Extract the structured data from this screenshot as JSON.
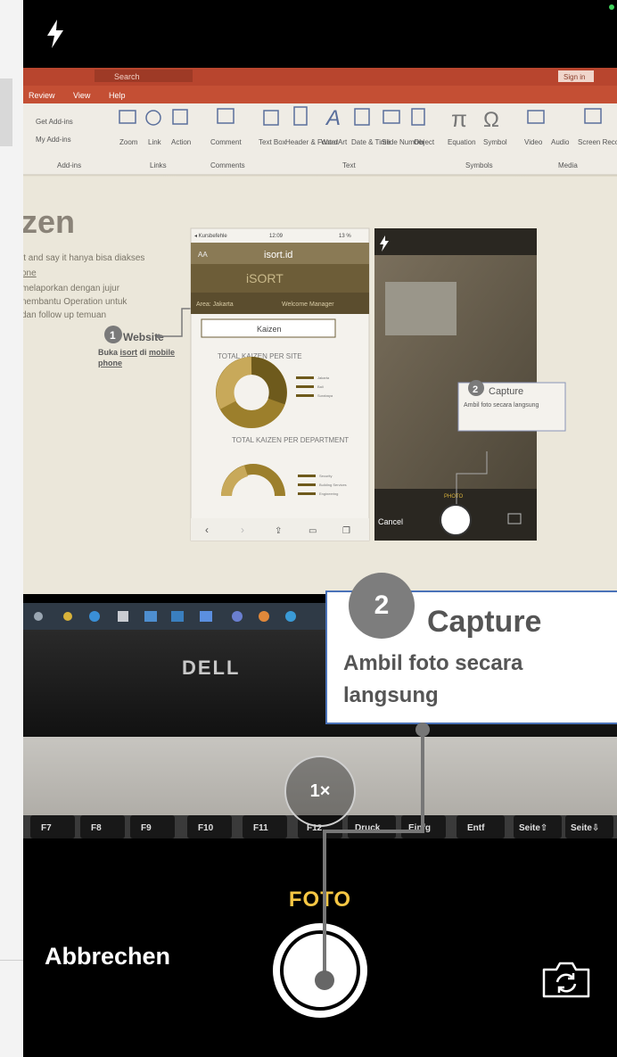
{
  "ribbon": {
    "search_placeholder": "Search",
    "sign_in_label": "Sign in",
    "tabs": [
      "Review",
      "View",
      "Help"
    ],
    "groups": {
      "addins": {
        "label": "Add-ins",
        "items": [
          "Get Add-ins",
          "My Add-ins"
        ]
      },
      "links": {
        "label": "Links",
        "items": [
          "Zoom",
          "Link",
          "Action"
        ]
      },
      "comments": {
        "label": "Comments",
        "items": [
          "Comment"
        ]
      },
      "text": {
        "label": "Text",
        "items": [
          "Text Box",
          "Header & Footer",
          "WordArt",
          "Date & Time",
          "Slide Number",
          "Object"
        ]
      },
      "symbols": {
        "label": "Symbols",
        "items": [
          "Equation",
          "Symbol"
        ]
      },
      "media": {
        "label": "Media",
        "items": [
          "Video",
          "Audio",
          "Screen Recording"
        ]
      }
    }
  },
  "slide": {
    "title": "zen",
    "body_lines": [
      "it and say it hanya bisa diakses",
      "one",
      "melaporkan dengan jujur",
      "nembantu Operation untuk",
      "dan follow up temuan"
    ],
    "step1": {
      "number": "1",
      "title": "Website",
      "desc_prefix": "Buka ",
      "desc_link": "isort",
      "desc_middle": " di ",
      "desc_link2": "mobile",
      "desc_line2": "phone"
    }
  },
  "mini_phone": {
    "status_left": "◂ Kursbefehle",
    "status_time": "12:09",
    "status_right": "13 %",
    "font_size_label": "AA",
    "url": "isort.id",
    "brand": "iSORT",
    "filter_site": "Area: Jakarta",
    "filter_role": "Welcome Manager",
    "search_text": "Kaizen",
    "chart1_title": "TOTAL KAIZEN PER SITE",
    "chart1_legend": [
      "Jakarta",
      "Bali",
      "Surabaya"
    ],
    "chart2_title": "TOTAL KAIZEN PER DEPARTMENT",
    "chart2_legend": [
      "Security",
      "Building Services",
      "Engineering"
    ]
  },
  "mini_camera": {
    "step_number": "2",
    "step_title": "Capture",
    "step_desc": "Ambil foto secara langsung",
    "mode_label": "PHOTO",
    "cancel_label": "Cancel"
  },
  "laptop": {
    "brand": "DELL",
    "keys": [
      "F7",
      "F8",
      "F9",
      "F10",
      "F11",
      "F12",
      "Druck",
      "Einfg",
      "Entf",
      "Seite⇧",
      "Seite⇩"
    ]
  },
  "camera": {
    "zoom_label": "1×",
    "mode_label": "FOTO",
    "cancel_label": "Abbrechen",
    "icons": [
      "flash-icon",
      "switch-camera-icon"
    ]
  },
  "callout": {
    "number": "2",
    "title": "Capture",
    "description_line1": "Ambil foto secara",
    "description_line2": "langsung"
  },
  "colors": {
    "accent_yellow": "#f7c744",
    "callout_border": "#4a72b8",
    "callout_badge": "#7d7d7d",
    "donut_dark": "#6e5a1c",
    "donut_mid": "#9c7f2c",
    "donut_light": "#c8a95a"
  }
}
